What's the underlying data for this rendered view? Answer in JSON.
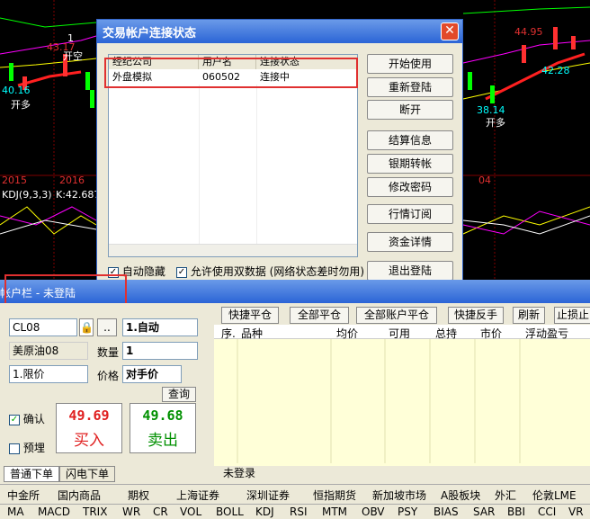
{
  "chart": {
    "left_price_high": "43.17",
    "left_price_low": "40.16",
    "right_price_high": "44.95",
    "right_price_mid": "42.28",
    "right_price_low": "38.14",
    "signal_open_long": "开多",
    "signal_open_short": "开空",
    "signal_one": "1",
    "year_2015": "2015",
    "year_2016": "2016",
    "year_04": "04",
    "kdj_label": "KDJ(9,3,3)",
    "kdj_value": "K:42.687"
  },
  "dialog": {
    "title": "交易帐户连接状态",
    "close": "✕",
    "columns": [
      "经纪公司",
      "用户名",
      "连接状态"
    ],
    "rows": [
      {
        "broker": "外盘模拟",
        "user": "060502",
        "status": "连接中"
      }
    ],
    "buttons": [
      "开始使用",
      "重新登陆",
      "断开",
      "结算信息",
      "银期转帐",
      "修改密码",
      "行情订阅",
      "资金详情",
      "退出登陆"
    ],
    "auto_hide_label": "自动隐藏",
    "dual_data_label": "允许使用双数据 (网络状态差时勿用)"
  },
  "account_bar": {
    "title": "帐户栏 - 未登陆"
  },
  "order": {
    "code": "CL08",
    "name": "美原油08",
    "mode": "1.自动",
    "qty_label": "数量",
    "qty": "1",
    "order_type": "1.限价",
    "price_label": "价格",
    "price": "对手价",
    "query": "查询",
    "confirm_label": "确认",
    "preorder_label": "预埋",
    "buy_price": "49.69",
    "buy_label": "买入",
    "sell_price": "49.68",
    "sell_label": "卖出",
    "more": ".."
  },
  "positions": {
    "buttons": [
      "快捷平仓",
      "全部平仓",
      "全部账户平仓",
      "快捷反手",
      "刷新",
      "止损止"
    ],
    "columns": [
      "序.",
      "品种",
      "均价",
      "可用",
      "总持",
      "市价",
      "浮动盈亏"
    ]
  },
  "tabs": {
    "normal": "普通下单",
    "flash": "闪电下单",
    "status": "未登录"
  },
  "markets": [
    "中金所",
    "国内商品",
    "期权",
    "上海证券",
    "深圳证券",
    "恒指期货",
    "新加坡市场",
    "A股板块",
    "外汇",
    "伦敦LME"
  ],
  "indicators": [
    "MA",
    "MACD",
    "TRIX",
    "WR",
    "CR",
    "VOL",
    "BOLL",
    "KDJ",
    "RSI",
    "MTM",
    "OBV",
    "PSY",
    "BIAS",
    "SAR",
    "BBI",
    "CCI",
    "VR"
  ],
  "colors": {
    "title_blue": "#2b64d6",
    "price_red": "#e02020",
    "price_green": "#009000",
    "panel": "#ece9d8",
    "grid_yellow": "#ffffd8"
  }
}
